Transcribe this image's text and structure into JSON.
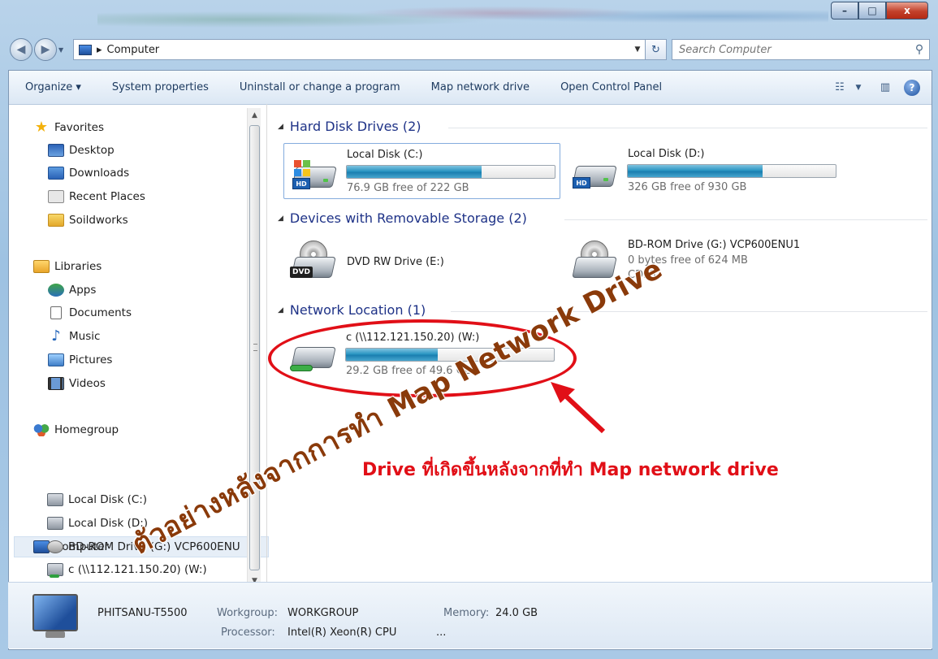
{
  "window": {
    "caption_buttons": {
      "minimize": "–",
      "maximize": "□",
      "close": "x"
    }
  },
  "address_bar": {
    "breadcrumb": "Computer",
    "separator": "▸"
  },
  "search": {
    "placeholder": "Search Computer"
  },
  "toolbar": {
    "buttons": [
      "Organize ▾",
      "System properties",
      "Uninstall or change a program",
      "Map network drive",
      "Open Control Panel"
    ]
  },
  "navigation": {
    "favorites": {
      "label": "Favorites",
      "items": [
        "Desktop",
        "Downloads",
        "Recent Places",
        "Soildworks"
      ]
    },
    "libraries": {
      "label": "Libraries",
      "items": [
        "Apps",
        "Documents",
        "Music",
        "Pictures",
        "Videos"
      ]
    },
    "homegroup": "Homegroup",
    "computer": {
      "label": "Computer",
      "items": [
        "Local Disk (C:)",
        "Local Disk (D:)",
        "BD-ROM Drive (G:) VCP600ENU",
        "c (\\\\112.121.150.20) (W:)"
      ]
    }
  },
  "groups": {
    "hard_disk": {
      "title": "Hard Disk Drives (2)",
      "drives": [
        {
          "name": "Local Disk (C:)",
          "free": "76.9 GB free of 222 GB",
          "used_fraction": 0.65
        },
        {
          "name": "Local Disk (D:)",
          "free": "326 GB free of 930 GB",
          "used_fraction": 0.65
        }
      ]
    },
    "removable": {
      "title": "Devices with Removable Storage (2)",
      "devices": [
        {
          "name": "DVD RW Drive (E:)",
          "tag": "DVD"
        },
        {
          "name": "BD-ROM Drive (G:) VCP600ENU1",
          "free": "0 bytes free of 624 MB",
          "fs": "CDFS"
        }
      ]
    },
    "network": {
      "title": "Network Location (1)",
      "locations": [
        {
          "name": "c (\\\\112.121.150.20) (W:)",
          "free": "29.2 GB free of 49.6 GB",
          "used_fraction": 0.44
        }
      ]
    }
  },
  "details": {
    "computer_name": "PHITSANU-T5500",
    "workgroup_label": "Workgroup:",
    "workgroup": "WORKGROUP",
    "memory_label": "Memory:",
    "memory": "24.0 GB",
    "processor_label": "Processor:",
    "processor": "Intel(R) Xeon(R) CPU",
    "processor_more": "..."
  },
  "annotations": {
    "caption": "Drive ที่เกิดขึ้นหลังจากที่ทำ Map network drive",
    "watermark": "ตัวอย่างหลังจากการทำ Map Network Drive",
    "colors": {
      "annotation": "#e10f17",
      "watermark": "#8a3a0a"
    }
  }
}
